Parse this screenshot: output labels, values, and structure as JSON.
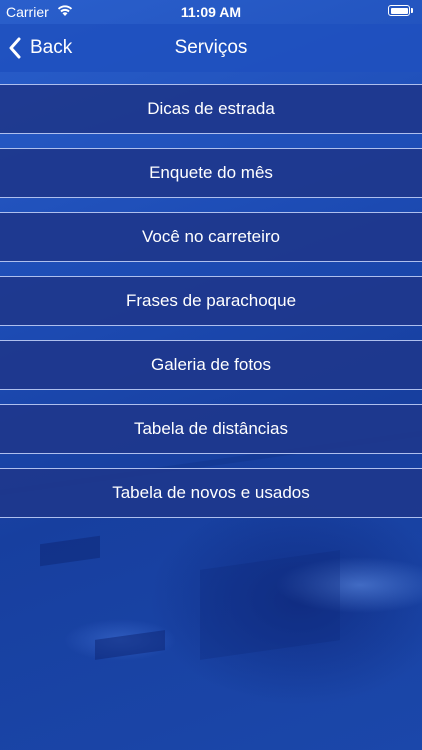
{
  "status_bar": {
    "carrier": "Carrier",
    "time": "11:09 AM",
    "wifi_icon": "wifi-icon",
    "battery_icon": "battery-icon"
  },
  "nav": {
    "back_label": "Back",
    "back_icon": "chevron-left-icon",
    "title": "Serviços"
  },
  "menu": {
    "items": [
      {
        "label": "Dicas de estrada"
      },
      {
        "label": "Enquete do mês"
      },
      {
        "label": "Você no carreteiro"
      },
      {
        "label": "Frases de parachoque"
      },
      {
        "label": "Galeria de fotos"
      },
      {
        "label": "Tabela de distâncias"
      },
      {
        "label": "Tabela de novos e usados"
      }
    ]
  },
  "colors": {
    "background": "#1f4fb4",
    "nav_bar": "#1e50be",
    "menu_item_bg": "#1e378c",
    "menu_item_border": "#c8d7ff",
    "text": "#ffffff"
  }
}
